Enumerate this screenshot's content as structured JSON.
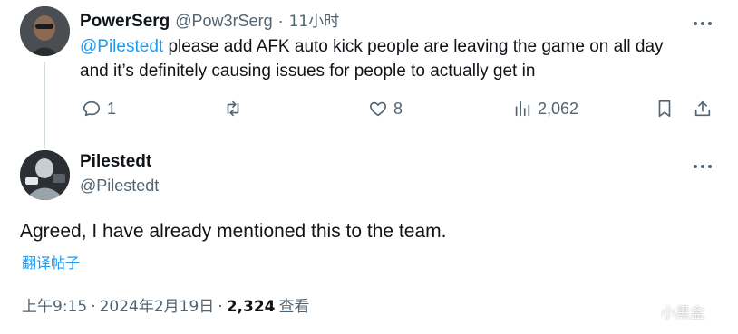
{
  "tweet1": {
    "display_name": "PowerSerg",
    "handle": "@Pow3rSerg",
    "separator": "·",
    "time": "11小时",
    "mention": "@Pilestedt",
    "text_line1_rest": " please add AFK auto kick people are leaving the game on all day",
    "text_line2": "and it’s definitely causing issues for people to actually get in",
    "replies": "1",
    "likes": "8",
    "views": "2,062",
    "more_icon": "ellipsis-icon"
  },
  "tweet2": {
    "display_name": "Pilestedt",
    "handle": "@Pilestedt",
    "text": "Agreed, I have already mentioned this to the team.",
    "translate_label": "翻译帖子",
    "time": "上午9:15",
    "dot": "·",
    "date": "2024年2月19日",
    "dot2": "·",
    "views_count": "2,324",
    "views_label": "查看",
    "more_icon": "ellipsis-icon"
  },
  "watermark": {
    "text": "小黑盒"
  },
  "colors": {
    "accent": "#1d9bf0",
    "secondary_text": "#536471",
    "primary_text": "#0f1419"
  }
}
